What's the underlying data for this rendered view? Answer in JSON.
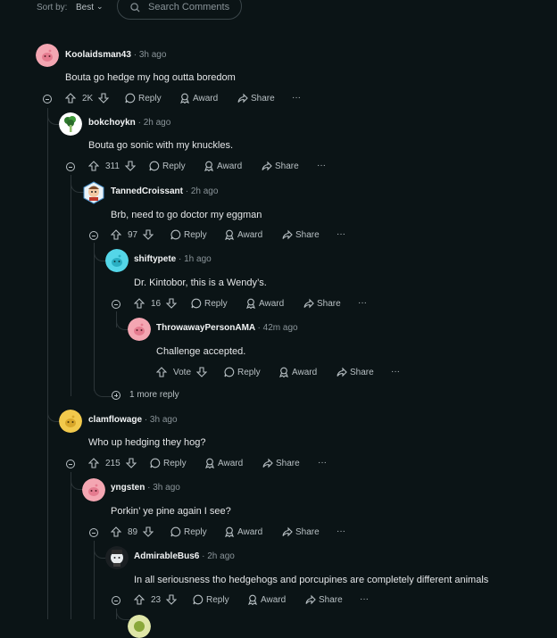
{
  "sort": {
    "label": "Sort by:",
    "value": "Best"
  },
  "search": {
    "placeholder": "Search Comments"
  },
  "actions": {
    "reply": "Reply",
    "award": "Award",
    "share": "Share",
    "more": "···",
    "vote": "Vote"
  },
  "more_replies": "1 more reply",
  "comments": [
    {
      "user": "Koolaidsman43",
      "time": "3h ago",
      "body": "Bouta go hedge my hog outta boredom",
      "votes": "2K"
    },
    {
      "user": "bokchoykn",
      "time": "2h ago",
      "body": "Bouta go sonic with my knuckles.",
      "votes": "311"
    },
    {
      "user": "TannedCroissant",
      "time": "2h ago",
      "body": "Brb, need to go doctor my eggman",
      "votes": "97"
    },
    {
      "user": "shiftypete",
      "time": "1h ago",
      "body": "Dr. Kintobor, this is a Wendy’s.",
      "votes": "16"
    },
    {
      "user": "ThrowawayPersonAMA",
      "time": "42m ago",
      "body": "Challenge accepted.",
      "votes": ""
    },
    {
      "user": "clamflowage",
      "time": "3h ago",
      "body": "Who up hedging they hog?",
      "votes": "215"
    },
    {
      "user": "yngsten",
      "time": "3h ago",
      "body": "Porkin’ ye pine again I see?",
      "votes": "89"
    },
    {
      "user": "AdmirableBus6",
      "time": "2h ago",
      "body": "In all seriousness tho hedgehogs and porcupines are completely different animals",
      "votes": "23"
    }
  ],
  "colors": {
    "background": "#0b1416",
    "snoo_pink": "#f4a6b2",
    "snoo_teal": "#54d6e8",
    "snoo_yellow": "#f2c94c",
    "text": "#d7dadc"
  }
}
